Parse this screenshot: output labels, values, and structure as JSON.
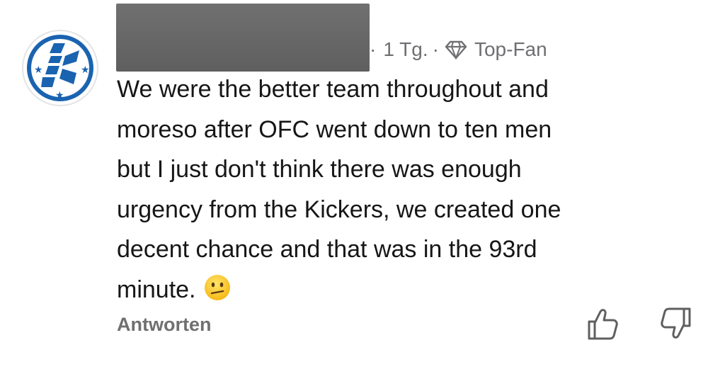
{
  "comment": {
    "author_redacted": true,
    "time_ago": "1 Tg.",
    "badge_icon": "diamond-icon",
    "badge_label": "Top-Fan",
    "text_lines": [
      "We were the better team throughout and",
      "moreso after OFC went down to ten men",
      "but I just don't think there was enough",
      "urgency from the Kickers, we created one",
      "decent chance and that was in the 93rd",
      "minute."
    ],
    "emoji": "confused-face-emoji",
    "reply_label": "Antworten",
    "like_icon": "thumbs-up-icon",
    "dislike_icon": "thumbs-down-icon"
  },
  "colors": {
    "avatar_blue": "#1a63b0",
    "meta_gray": "#6f6f73",
    "text": "#161616"
  }
}
